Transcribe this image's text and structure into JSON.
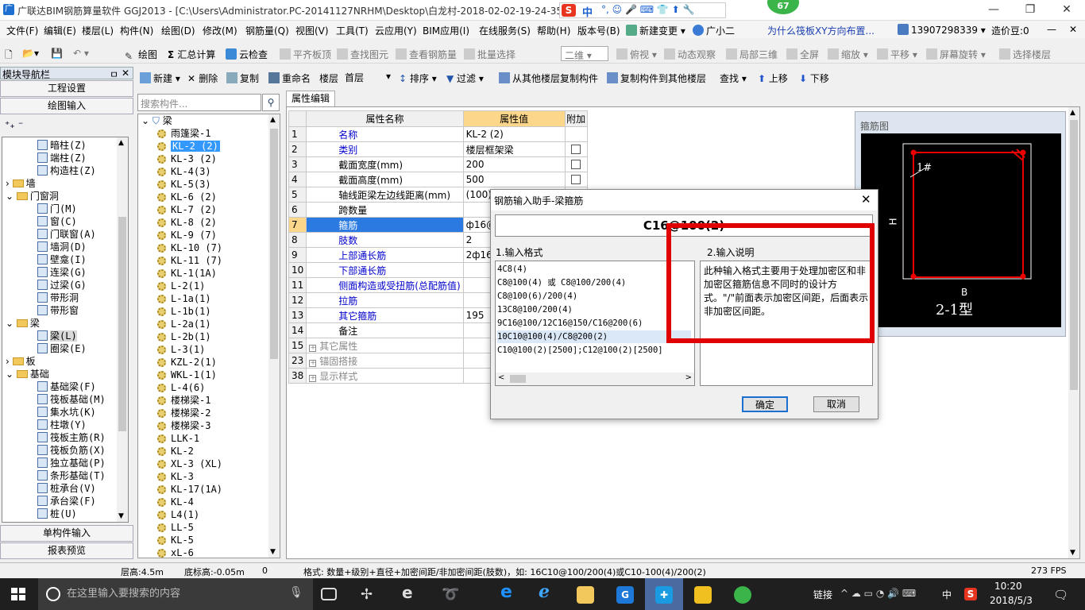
{
  "window": {
    "title": "广联达BIM钢筋算量软件 GGJ2013 - [C:\\Users\\Administrator.PC-20141127NRHM\\Desktop\\白龙村-2018-02-02-19-24-35",
    "ime": "中",
    "badge": "67"
  },
  "menu": [
    "文件(F)",
    "编辑(E)",
    "楼层(L)",
    "构件(N)",
    "绘图(D)",
    "修改(M)",
    "钢筋量(Q)",
    "视图(V)",
    "工具(T)",
    "云应用(Y)",
    "BIM应用(I)",
    "在线服务(S)",
    "帮助(H)",
    "版本号(B)"
  ],
  "menu_extra": {
    "change": "新建变更",
    "assistant": "广小二",
    "question": "为什么筏板XY方向布置...",
    "phone": "13907298339",
    "beans": "造价豆:0"
  },
  "toolbar1": {
    "draw": "绘图",
    "sum": "汇总计算",
    "cloud": "云检查",
    "flat": "平齐板顶",
    "find": "查找图元",
    "view_qty": "查看钢筋量",
    "batch": "批量选择",
    "view2d": "二维",
    "topview": "俯视",
    "dynamic": "动态观察",
    "local3d": "局部三维",
    "fullscreen": "全屏",
    "zoom": "缩放",
    "pan": "平移",
    "rotate": "屏幕旋转",
    "select_floor": "选择楼层"
  },
  "toolbar2": {
    "new": "新建",
    "delete": "删除",
    "copy": "复制",
    "rename": "重命名",
    "floor_label": "楼层",
    "floor_value": "首层",
    "sort": "排序",
    "filter": "过滤",
    "copy_from": "从其他楼层复制构件",
    "copy_to": "复制构件到其他楼层",
    "find": "查找",
    "up": "上移",
    "down": "下移"
  },
  "nav": {
    "header": "模块导航栏",
    "btn_settings": "工程设置",
    "btn_draw": "绘图输入",
    "btn_single": "单构件输入",
    "btn_report": "报表预览",
    "tree": [
      {
        "label": "暗柱(Z)",
        "indent": 2,
        "type": "item"
      },
      {
        "label": "端柱(Z)",
        "indent": 2,
        "type": "item"
      },
      {
        "label": "构造柱(Z)",
        "indent": 2,
        "type": "item"
      },
      {
        "label": "墙",
        "indent": 1,
        "type": "folder-closed"
      },
      {
        "label": "门窗洞",
        "indent": 1,
        "type": "folder-open"
      },
      {
        "label": "门(M)",
        "indent": 2,
        "type": "item"
      },
      {
        "label": "窗(C)",
        "indent": 2,
        "type": "item"
      },
      {
        "label": "门联窗(A)",
        "indent": 2,
        "type": "item"
      },
      {
        "label": "墙洞(D)",
        "indent": 2,
        "type": "item"
      },
      {
        "label": "壁龛(I)",
        "indent": 2,
        "type": "item"
      },
      {
        "label": "连梁(G)",
        "indent": 2,
        "type": "item"
      },
      {
        "label": "过梁(G)",
        "indent": 2,
        "type": "item"
      },
      {
        "label": "带形洞",
        "indent": 2,
        "type": "item"
      },
      {
        "label": "带形窗",
        "indent": 2,
        "type": "item"
      },
      {
        "label": "梁",
        "indent": 1,
        "type": "folder-open"
      },
      {
        "label": "梁(L)",
        "indent": 2,
        "type": "item-sel"
      },
      {
        "label": "圈梁(E)",
        "indent": 2,
        "type": "item"
      },
      {
        "label": "板",
        "indent": 1,
        "type": "folder-closed"
      },
      {
        "label": "基础",
        "indent": 1,
        "type": "folder-open"
      },
      {
        "label": "基础梁(F)",
        "indent": 2,
        "type": "item"
      },
      {
        "label": "筏板基础(M)",
        "indent": 2,
        "type": "item"
      },
      {
        "label": "集水坑(K)",
        "indent": 2,
        "type": "item"
      },
      {
        "label": "柱墩(Y)",
        "indent": 2,
        "type": "item"
      },
      {
        "label": "筏板主筋(R)",
        "indent": 2,
        "type": "item"
      },
      {
        "label": "筏板负筋(X)",
        "indent": 2,
        "type": "item"
      },
      {
        "label": "独立基础(P)",
        "indent": 2,
        "type": "item"
      },
      {
        "label": "条形基础(T)",
        "indent": 2,
        "type": "item"
      },
      {
        "label": "桩承台(V)",
        "indent": 2,
        "type": "item"
      },
      {
        "label": "承台梁(F)",
        "indent": 2,
        "type": "item"
      },
      {
        "label": "桩(U)",
        "indent": 2,
        "type": "item"
      }
    ]
  },
  "components": {
    "search_placeholder": "搜索构件...",
    "root": "梁",
    "items": [
      "雨篷梁-1",
      "KL-2 (2)",
      "KL-3 (2)",
      "KL-4(3)",
      "KL-5(3)",
      "KL-6 (2)",
      "KL-7 (2)",
      "KL-8 (2)",
      "KL-9 (7)",
      "KL-10 (7)",
      "KL-11 (7)",
      "KL-1(1A)",
      "L-2(1)",
      "L-1a(1)",
      "L-1b(1)",
      "L-2a(1)",
      "L-2b(1)",
      "L-3(1)",
      "KZL-2(1)",
      "WKL-1(1)",
      "L-4(6)",
      "楼梯梁-1",
      "楼梯梁-2",
      "楼梯梁-3",
      "LLK-1",
      "KL-2",
      "XL-3 (XL)",
      "KL-3",
      "KL-17(1A)",
      "KL-4",
      "L4(1)",
      "LL-5",
      "KL-5",
      "xL-6"
    ],
    "selected_index": 1
  },
  "props": {
    "tab": "属性编辑",
    "headers": {
      "name": "属性名称",
      "value": "属性值",
      "extra": "附加"
    },
    "rows": [
      {
        "n": "1",
        "name": "名称",
        "value": "KL-2 (2)",
        "cb": false,
        "blue": true
      },
      {
        "n": "2",
        "name": "类别",
        "value": "楼层框架梁",
        "cb": true,
        "blue": true
      },
      {
        "n": "3",
        "name": "截面宽度(mm)",
        "value": "200",
        "cb": true,
        "blue": false
      },
      {
        "n": "4",
        "name": "截面高度(mm)",
        "value": "500",
        "cb": true,
        "blue": false
      },
      {
        "n": "5",
        "name": "轴线距梁左边线距离(mm)",
        "value": "(100)",
        "cb": false,
        "blue": false
      },
      {
        "n": "6",
        "name": "跨数量",
        "value": "",
        "cb": false,
        "blue": false
      },
      {
        "n": "7",
        "name": "箍筋",
        "value": "ф16@10",
        "cb": false,
        "blue": true,
        "sel": true
      },
      {
        "n": "8",
        "name": "肢数",
        "value": "2",
        "cb": false,
        "blue": true
      },
      {
        "n": "9",
        "name": "上部通长筋",
        "value": "2ф16",
        "cb": false,
        "blue": true
      },
      {
        "n": "10",
        "name": "下部通长筋",
        "value": "",
        "cb": false,
        "blue": true
      },
      {
        "n": "11",
        "name": "侧面构造或受扭筋(总配筋值)",
        "value": "",
        "cb": false,
        "blue": true
      },
      {
        "n": "12",
        "name": "拉筋",
        "value": "",
        "cb": false,
        "blue": true
      },
      {
        "n": "13",
        "name": "其它箍筋",
        "value": "195",
        "cb": false,
        "blue": true
      },
      {
        "n": "14",
        "name": "备注",
        "value": "",
        "cb": false,
        "blue": false
      },
      {
        "n": "15",
        "name": "其它属性",
        "value": "",
        "cb": false,
        "blue": false,
        "group": true
      },
      {
        "n": "23",
        "name": "锚固搭接",
        "value": "",
        "cb": false,
        "blue": false,
        "group": true
      },
      {
        "n": "38",
        "name": "显示样式",
        "value": "",
        "cb": false,
        "blue": false,
        "group": true
      }
    ]
  },
  "preview": {
    "title": "箍筋图",
    "label_1": "1#",
    "label_h": "H",
    "label_b": "B",
    "label_type": "2-1型"
  },
  "dialog": {
    "title": "钢筋输入助手-梁箍筋",
    "formula": "C16@100(2)",
    "section1": "1.输入格式",
    "section2": "2.输入说明",
    "formats": [
      "4C8(4)",
      "C8@100(4) 或 C8@100/200(4)",
      "C8@100(6)/200(4)",
      "13C8@100/200(4)",
      "9C16@100/12C16@150/C16@200(6)",
      "10C10@100(4)/C8@200(2)",
      "C10@100(2)[2500];C12@100(2)[2500]"
    ],
    "selected_format": 5,
    "description": "此种输入格式主要用于处理加密区和非加密区箍筋信息不同时的设计方式。\"/\"前面表示加密区间距，后面表示非加密区间距。",
    "ok": "确定",
    "cancel": "取消"
  },
  "status": {
    "floor_height": "层高:4.5m",
    "base_height": "底标高:-0.05m",
    "zero": "0",
    "hint": "格式: 数量+级别+直径+加密间距/非加密间距(肢数)，如: 16C10@100/200(4)或C10-100(4)/200(2)",
    "fps": "273 FPS"
  },
  "taskbar": {
    "search": "在这里输入要搜索的内容",
    "link": "链接",
    "ime": "中",
    "time": "10:20",
    "date": "2018/5/3"
  }
}
